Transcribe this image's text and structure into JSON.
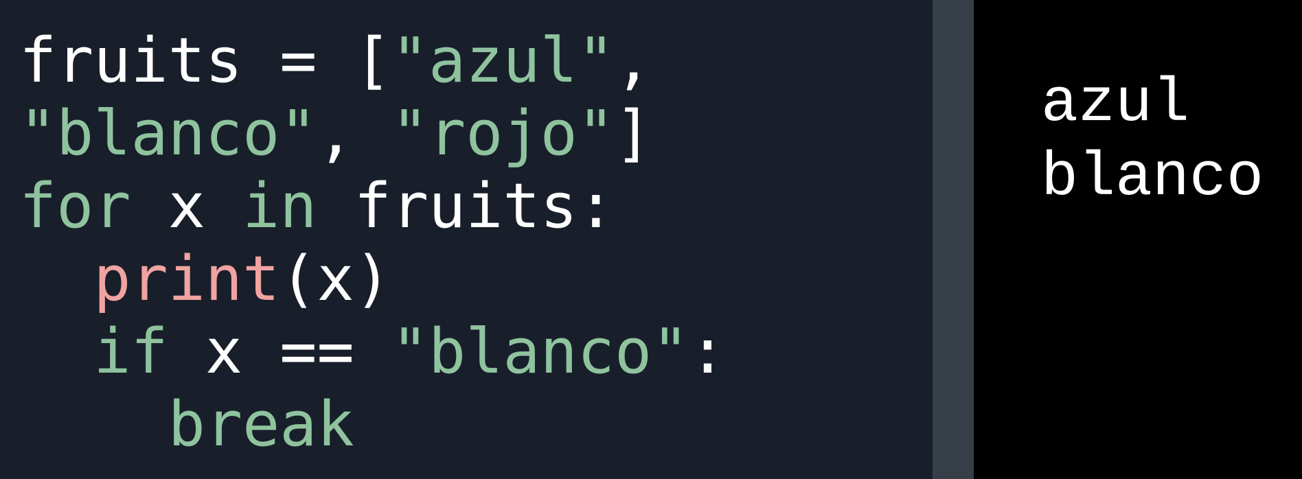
{
  "colors": {
    "editor_background": "#181f2b",
    "divider": "#363f48",
    "output_background": "#000000",
    "plain_text": "#ffffff",
    "string_and_keyword": "#8fc39e",
    "function_name": "#f0a3a0"
  },
  "editor": {
    "lines": [
      {
        "tokens": [
          {
            "type": "plain",
            "text": "fruits = ["
          },
          {
            "type": "str",
            "text": "\"azul\""
          },
          {
            "type": "plain",
            "text": ","
          }
        ]
      },
      {
        "tokens": [
          {
            "type": "str",
            "text": "\"blanco\""
          },
          {
            "type": "plain",
            "text": ", "
          },
          {
            "type": "str",
            "text": "\"rojo\""
          },
          {
            "type": "plain",
            "text": "]"
          }
        ]
      },
      {
        "tokens": [
          {
            "type": "kw",
            "text": "for"
          },
          {
            "type": "plain",
            "text": " x "
          },
          {
            "type": "kw",
            "text": "in"
          },
          {
            "type": "plain",
            "text": " fruits:"
          }
        ]
      },
      {
        "tokens": [
          {
            "type": "plain",
            "text": "  "
          },
          {
            "type": "fn",
            "text": "print"
          },
          {
            "type": "plain",
            "text": "(x)"
          }
        ]
      },
      {
        "tokens": [
          {
            "type": "plain",
            "text": "  "
          },
          {
            "type": "kw",
            "text": "if"
          },
          {
            "type": "plain",
            "text": " x == "
          },
          {
            "type": "str",
            "text": "\"blanco\""
          },
          {
            "type": "plain",
            "text": ":"
          }
        ]
      },
      {
        "tokens": [
          {
            "type": "plain",
            "text": "    "
          },
          {
            "type": "kw",
            "text": "break"
          }
        ]
      }
    ]
  },
  "output": {
    "lines": [
      "azul",
      "blanco"
    ]
  }
}
